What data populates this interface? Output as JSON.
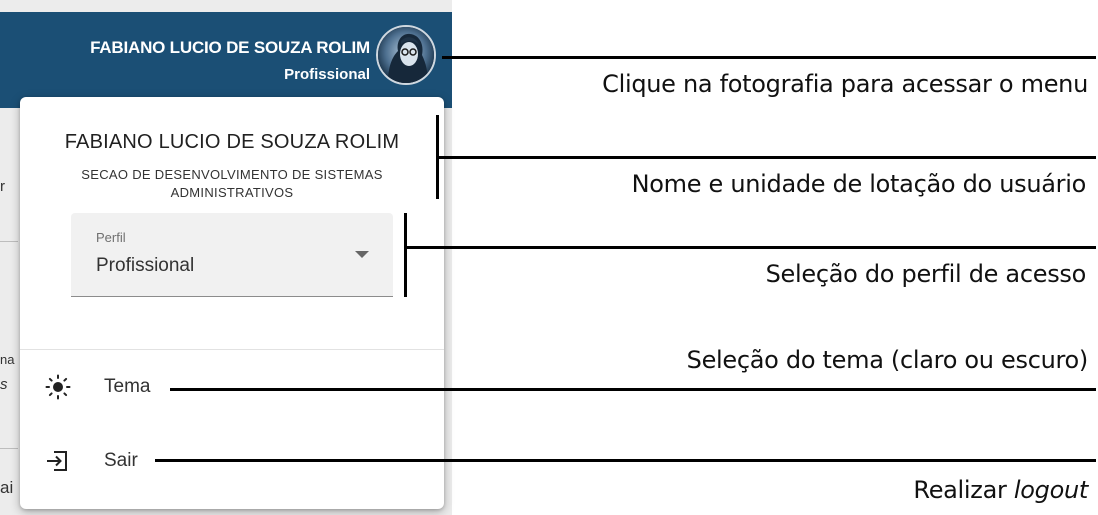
{
  "header": {
    "user_name": "FABIANO LUCIO DE SOUZA ROLIM",
    "role": "Profissional",
    "avatar_icon": "user-photo"
  },
  "background_fragments": {
    "frag1": "r",
    "frag2": "na",
    "frag3": "s",
    "frag4": "ai"
  },
  "menu": {
    "user_name": "FABIANO LUCIO DE SOUZA ROLIM",
    "unit": "SECAO DE DESENVOLVIMENTO DE SISTEMAS ADMINISTRATIVOS",
    "profile_select": {
      "label": "Perfil",
      "value": "Profissional"
    },
    "items": [
      {
        "label": "Tema",
        "icon": "sun-icon"
      },
      {
        "label": "Sair",
        "icon": "logout-icon"
      }
    ]
  },
  "annotations": {
    "photo": "Clique na fotografia para acessar o menu",
    "name_unit": "Nome e unidade de lotação do usuário",
    "profile": "Seleção do perfil de acesso",
    "theme": "Seleção do tema (claro ou escuro)",
    "logout_prefix": "Realizar ",
    "logout_em": "logout"
  },
  "colors": {
    "header_bg": "#1b4f75",
    "annotation_line": "#000000"
  }
}
